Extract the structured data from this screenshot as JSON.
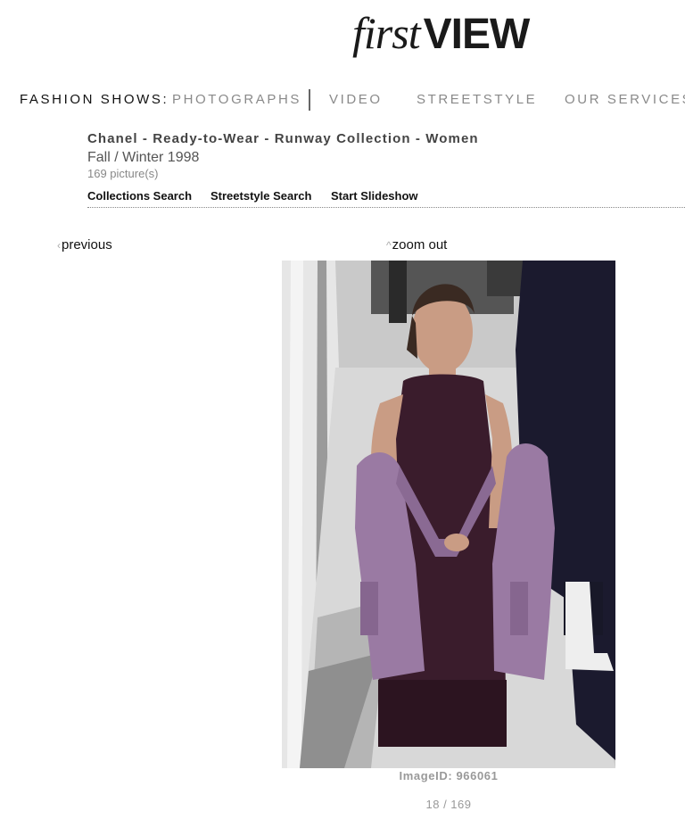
{
  "logo": {
    "first": "first",
    "view": "VIEW"
  },
  "nav": {
    "label": "FASHION SHOWS:",
    "items": [
      "PHOTOGRAPHS",
      "VIDEO",
      "STREETSTYLE",
      "OUR SERVICES"
    ]
  },
  "collection": {
    "title": "Chanel - Ready-to-Wear - Runway Collection - Women",
    "season": "Fall / Winter 1998",
    "count": "169 picture(s)"
  },
  "links": [
    "Collections Search",
    "Streetstyle Search",
    "Start Slideshow"
  ],
  "navigation": {
    "previous": "previous",
    "zoom_out": "zoom out",
    "prev_arrow": "‹",
    "zoom_arrow": "^"
  },
  "photo": {
    "image_id": "ImageID: 966061",
    "paging": "18 / 169"
  },
  "colors": {
    "dress": "#3a1c2c",
    "cardigan": "#9a7aa3",
    "runway": "#d8d8d8",
    "background_figure": "#1b1a2e",
    "boot": "#eeeeee"
  }
}
